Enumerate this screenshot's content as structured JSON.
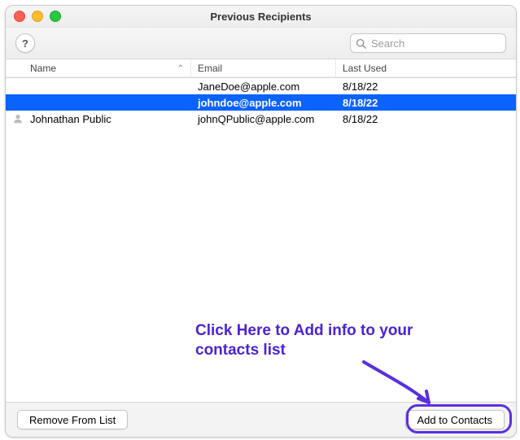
{
  "window": {
    "title": "Previous Recipients"
  },
  "toolbar": {
    "help_symbol": "?",
    "search_placeholder": "Search"
  },
  "columns": {
    "name": "Name",
    "email": "Email",
    "last_used": "Last Used",
    "sort_indicator": "⌃"
  },
  "rows": [
    {
      "name": "",
      "email": "JaneDoe@apple.com",
      "last_used": "8/18/22",
      "selected": false,
      "has_contact_icon": false
    },
    {
      "name": "",
      "email": "johndoe@apple.com",
      "last_used": "8/18/22",
      "selected": true,
      "has_contact_icon": false
    },
    {
      "name": "Johnathan Public",
      "email": "johnQPublic@apple.com",
      "last_used": "8/18/22",
      "selected": false,
      "has_contact_icon": true
    }
  ],
  "footer": {
    "remove_label": "Remove From List",
    "add_label": "Add to Contacts"
  },
  "annotation": {
    "text": "Click Here to Add info to your contacts list"
  },
  "colors": {
    "selection": "#0a62ff",
    "annotation": "#5a2fe0"
  }
}
